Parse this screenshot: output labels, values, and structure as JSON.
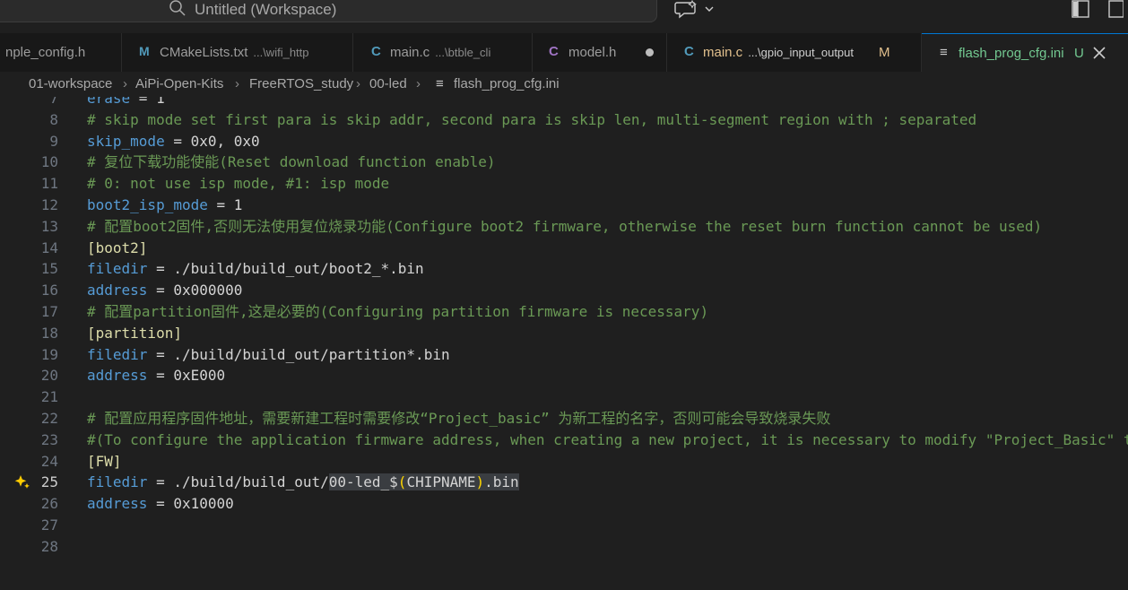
{
  "titlebar": {
    "title": "Untitled (Workspace)"
  },
  "tabs": [
    {
      "icon": "",
      "name": "nple_config.h",
      "path": "",
      "modifier": "",
      "dirty": false,
      "icon_color": "#a074c4"
    },
    {
      "icon": "M",
      "name": "CMakeLists.txt",
      "path": "...\\wifi_http",
      "modifier": "",
      "dirty": false,
      "icon_color": "#6d8086"
    },
    {
      "icon": "C",
      "name": "main.c",
      "path": "...\\btble_cli",
      "modifier": "",
      "dirty": false,
      "icon_color": "#519aba"
    },
    {
      "icon": "C",
      "name": "model.h",
      "path": "",
      "modifier": "",
      "dirty": true,
      "icon_color": "#a074c4"
    },
    {
      "icon": "C",
      "name": "main.c",
      "path": "...\\gpio_input_output",
      "modifier": "M",
      "dirty": false,
      "icon_color": "#519aba"
    },
    {
      "icon": "≡",
      "name": "flash_prog_cfg.ini",
      "path": "",
      "modifier": "U",
      "dirty": false,
      "icon_color": "#cccccc"
    }
  ],
  "breadcrumb": [
    "01-workspace",
    "AiPi-Open-Kits",
    "FreeRTOS_study",
    "00-led",
    "flash_prog_cfg.ini"
  ],
  "editor": {
    "current_line": "25",
    "lines": [
      {
        "n": "7",
        "parts": [
          {
            "t": "erase",
            "c": "key"
          },
          {
            "t": " = 1",
            "c": "val"
          }
        ]
      },
      {
        "n": "8",
        "parts": [
          {
            "t": "# skip mode set first para is skip addr, second para is skip len, multi-segment region with ; separated",
            "c": "cm"
          }
        ]
      },
      {
        "n": "9",
        "parts": [
          {
            "t": "skip_mode",
            "c": "key"
          },
          {
            "t": " = 0x0, 0x0",
            "c": "val"
          }
        ]
      },
      {
        "n": "10",
        "parts": [
          {
            "t": "# 复位下载功能使能(Reset download function enable)",
            "c": "cm"
          }
        ]
      },
      {
        "n": "11",
        "parts": [
          {
            "t": "# 0: not use isp mode, #1: isp mode",
            "c": "cm"
          }
        ]
      },
      {
        "n": "12",
        "parts": [
          {
            "t": "boot2_isp_mode",
            "c": "key"
          },
          {
            "t": " = 1",
            "c": "val"
          }
        ]
      },
      {
        "n": "13",
        "parts": [
          {
            "t": "# 配置boot2固件,否则无法使用复位烧录功能(Configure boot2 firmware, otherwise the reset burn function cannot be used)",
            "c": "cm"
          }
        ]
      },
      {
        "n": "14",
        "parts": [
          {
            "t": "[boot2]",
            "c": "sec"
          }
        ]
      },
      {
        "n": "15",
        "parts": [
          {
            "t": "filedir",
            "c": "key"
          },
          {
            "t": " = ./build/build_out/boot2_*.bin",
            "c": "val"
          }
        ]
      },
      {
        "n": "16",
        "parts": [
          {
            "t": "address",
            "c": "key"
          },
          {
            "t": " = 0x000000",
            "c": "val"
          }
        ]
      },
      {
        "n": "17",
        "parts": [
          {
            "t": "# 配置partition固件,这是必要的(Configuring partition firmware is necessary)",
            "c": "cm"
          }
        ]
      },
      {
        "n": "18",
        "parts": [
          {
            "t": "[partition]",
            "c": "sec"
          }
        ]
      },
      {
        "n": "19",
        "parts": [
          {
            "t": "filedir",
            "c": "key"
          },
          {
            "t": " = ./build/build_out/partition*.bin",
            "c": "val"
          }
        ]
      },
      {
        "n": "20",
        "parts": [
          {
            "t": "address",
            "c": "key"
          },
          {
            "t": " = 0xE000",
            "c": "val"
          }
        ]
      },
      {
        "n": "21",
        "parts": []
      },
      {
        "n": "22",
        "parts": [
          {
            "t": "# 配置应用程序固件地址，需要新建工程时需要修改“Project_basic” 为新工程的名字，否则可能会导致烧录失败",
            "c": "cm"
          }
        ]
      },
      {
        "n": "23",
        "parts": [
          {
            "t": "#(To configure the application firmware address, when creating a new project, it is necessary to modify \"Project_Basic\" to",
            "c": "cm"
          }
        ]
      },
      {
        "n": "24",
        "parts": [
          {
            "t": "[FW]",
            "c": "sec"
          }
        ]
      },
      {
        "n": "25",
        "parts": [
          {
            "t": "filedir",
            "c": "key"
          },
          {
            "t": " = ./build/build_out/",
            "c": "val"
          },
          {
            "t": "00-led_$",
            "c": "val hl"
          },
          {
            "t": "(",
            "c": "var-paren hl"
          },
          {
            "t": "CHIPNAME",
            "c": "val hl"
          },
          {
            "t": ")",
            "c": "var-paren hl"
          },
          {
            "t": ".bin",
            "c": "val hl"
          }
        ]
      },
      {
        "n": "26",
        "parts": [
          {
            "t": "address",
            "c": "key"
          },
          {
            "t": " = 0x10000",
            "c": "val"
          }
        ]
      },
      {
        "n": "27",
        "parts": []
      },
      {
        "n": "28",
        "parts": []
      }
    ]
  }
}
